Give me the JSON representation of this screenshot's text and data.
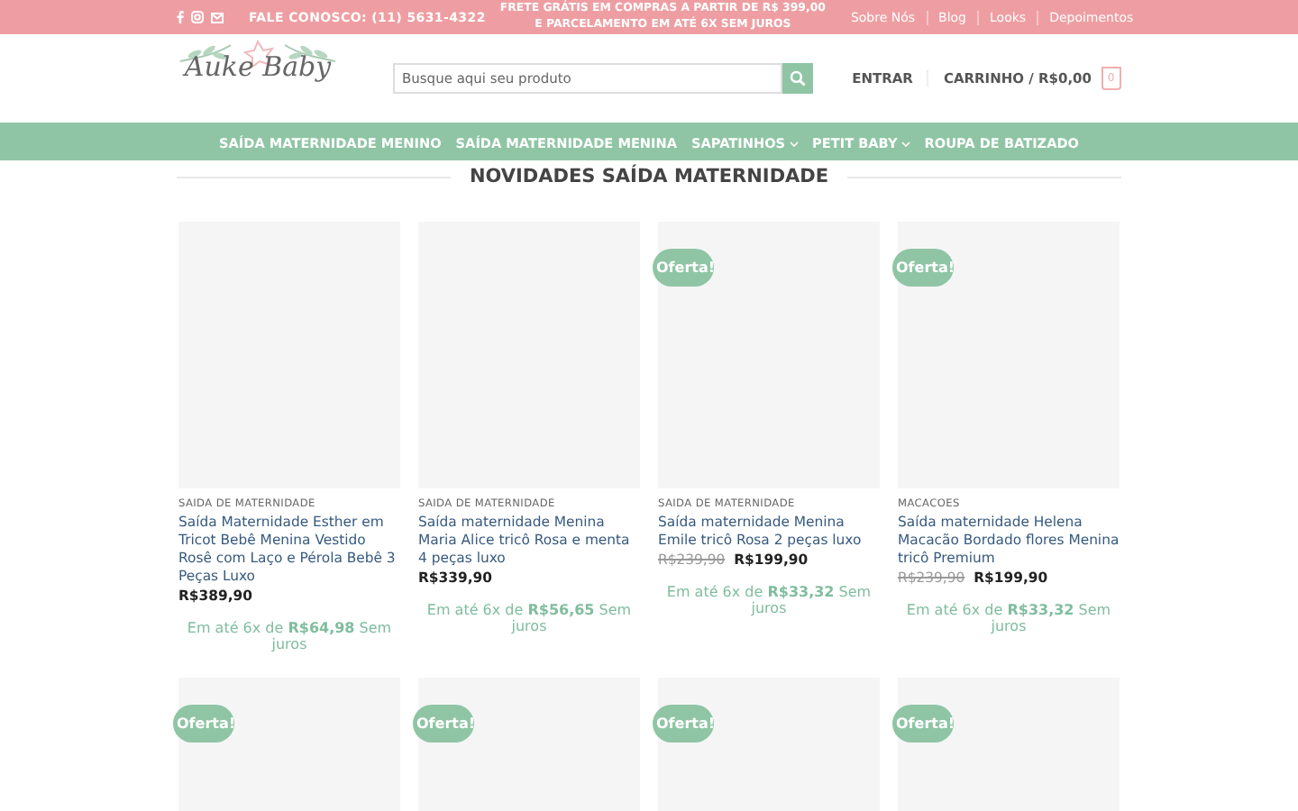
{
  "top_bar": {
    "contact": "FALE CONOSCO: (11) 5631-4322",
    "promo": [
      "FRETE GRÁTIS EM COMPRAS A PARTIR DE R$ 399,00",
      "E PARCELAMENTO EM ATÉ 6X SEM JUROS"
    ],
    "links": [
      "Sobre Nós",
      "Blog",
      "Looks",
      "Depoimentos"
    ]
  },
  "header": {
    "logo": "Auke Baby",
    "search": {
      "placeholder": "Busque aqui seu produto"
    },
    "login": "ENTRAR",
    "cart": "CARRINHO / R$0,00",
    "cart_count": "0"
  },
  "nav": [
    {
      "label": "SAÍDA MATERNIDADE MENINO",
      "dropdown": false
    },
    {
      "label": "SAÍDA MATERNIDADE MENINA",
      "dropdown": false
    },
    {
      "label": "SAPATINHOS",
      "dropdown": true
    },
    {
      "label": "PETIT BABY",
      "dropdown": true
    },
    {
      "label": "ROUPA DE BATIZADO",
      "dropdown": false
    }
  ],
  "section_title": "NOVIDADES SAÍDA MATERNIDADE",
  "products": [
    {
      "offer": false,
      "category": "SAIDA DE MATERNIDADE",
      "name": "Saída Maternidade Esther em Tricot Bebê Menina Vestido Rosê com Laço e Pérola Bebê 3 Peças Luxo",
      "price": "R$389,90",
      "installments": "Em até 6x de **R$64,98** Sem juros"
    },
    {
      "offer": false,
      "category": "SAIDA DE MATERNIDADE",
      "name": "Saída maternidade Menina Maria Alice tricô Rosa e menta 4 peças luxo",
      "price": "R$339,90",
      "installments": "Em até 6x de **R$56,65** Sem juros"
    },
    {
      "offer": true,
      "badge": "Oferta!",
      "category": "SAIDA DE MATERNIDADE",
      "name": "Saída maternidade Menina Emile tricô Rosa 2 peças luxo",
      "old_price": "R$239,90",
      "price": "R$199,90",
      "installments": "Em até 6x de **R$33,32** Sem juros"
    },
    {
      "offer": true,
      "badge": "Oferta!",
      "category": "MACACOES",
      "name": "Saída maternidade Helena Macacão Bordado flores Menina tricô Premium",
      "old_price": "R$239,90",
      "price": "R$199,90",
      "installments": "Em até 6x de **R$33,32** Sem juros"
    },
    {
      "offer": true,
      "badge": "Oferta!"
    },
    {
      "offer": true,
      "badge": "Oferta!"
    },
    {
      "offer": true,
      "badge": "Oferta!"
    },
    {
      "offer": true,
      "badge": "Oferta!"
    }
  ]
}
